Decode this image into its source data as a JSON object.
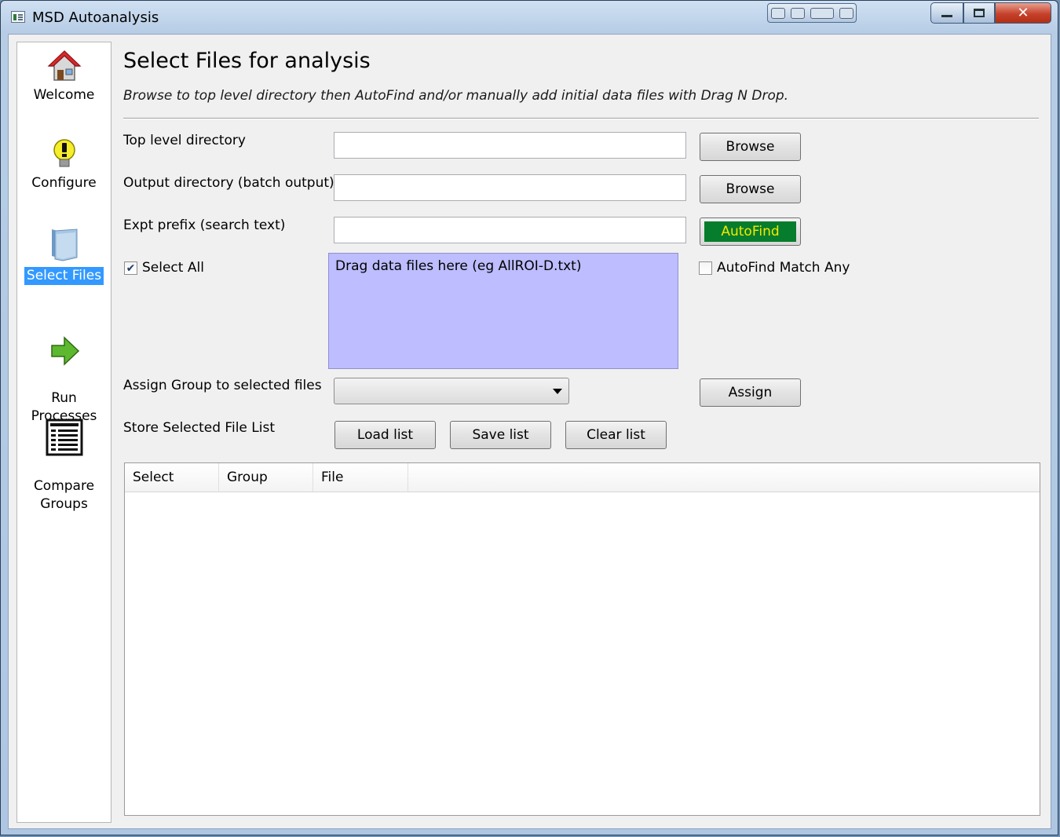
{
  "window": {
    "title": "MSD Autoanalysis",
    "close_glyph": "✕"
  },
  "sidebar": {
    "items": [
      {
        "label": "Welcome",
        "icon": "home-icon"
      },
      {
        "label": "Configure",
        "icon": "lightbulb-icon"
      },
      {
        "label": "Select Files",
        "icon": "folder-icon",
        "active": true
      },
      {
        "label": "Run\nProcesses",
        "icon": "green-arrow-icon"
      },
      {
        "label": "Compare\nGroups",
        "icon": "table-icon"
      }
    ]
  },
  "main": {
    "title": "Select Files for analysis",
    "subtitle": "Browse to top level directory then AutoFind and/or manually add initial data files with Drag N Drop.",
    "fields": {
      "top_level_label": "Top level directory",
      "top_level_value": "",
      "output_label": "Output directory (batch output)",
      "output_value": "",
      "prefix_label": "Expt prefix (search text)",
      "prefix_value": ""
    },
    "buttons": {
      "browse_top": "Browse",
      "browse_output": "Browse",
      "autofind": "AutoFind",
      "assign": "Assign",
      "load_list": "Load list",
      "save_list": "Save list",
      "clear_list": "Clear list"
    },
    "select_all_label": "Select All",
    "select_all_checked": true,
    "dropzone_text": "Drag data files here (eg AllROI-D.txt)",
    "autofind_match_any_label": "AutoFind Match Any",
    "autofind_match_any_checked": false,
    "assign_group_label": "Assign Group to selected files",
    "assign_group_value": "",
    "store_list_label": "Store Selected File List",
    "table": {
      "columns": [
        "Select",
        "Group",
        "File"
      ],
      "rows": []
    }
  },
  "colors": {
    "accent_selected": "#3399ff",
    "autofind_bg": "#067d2c",
    "autofind_text": "#f5e800",
    "dropzone_bg": "#bdbdff"
  }
}
